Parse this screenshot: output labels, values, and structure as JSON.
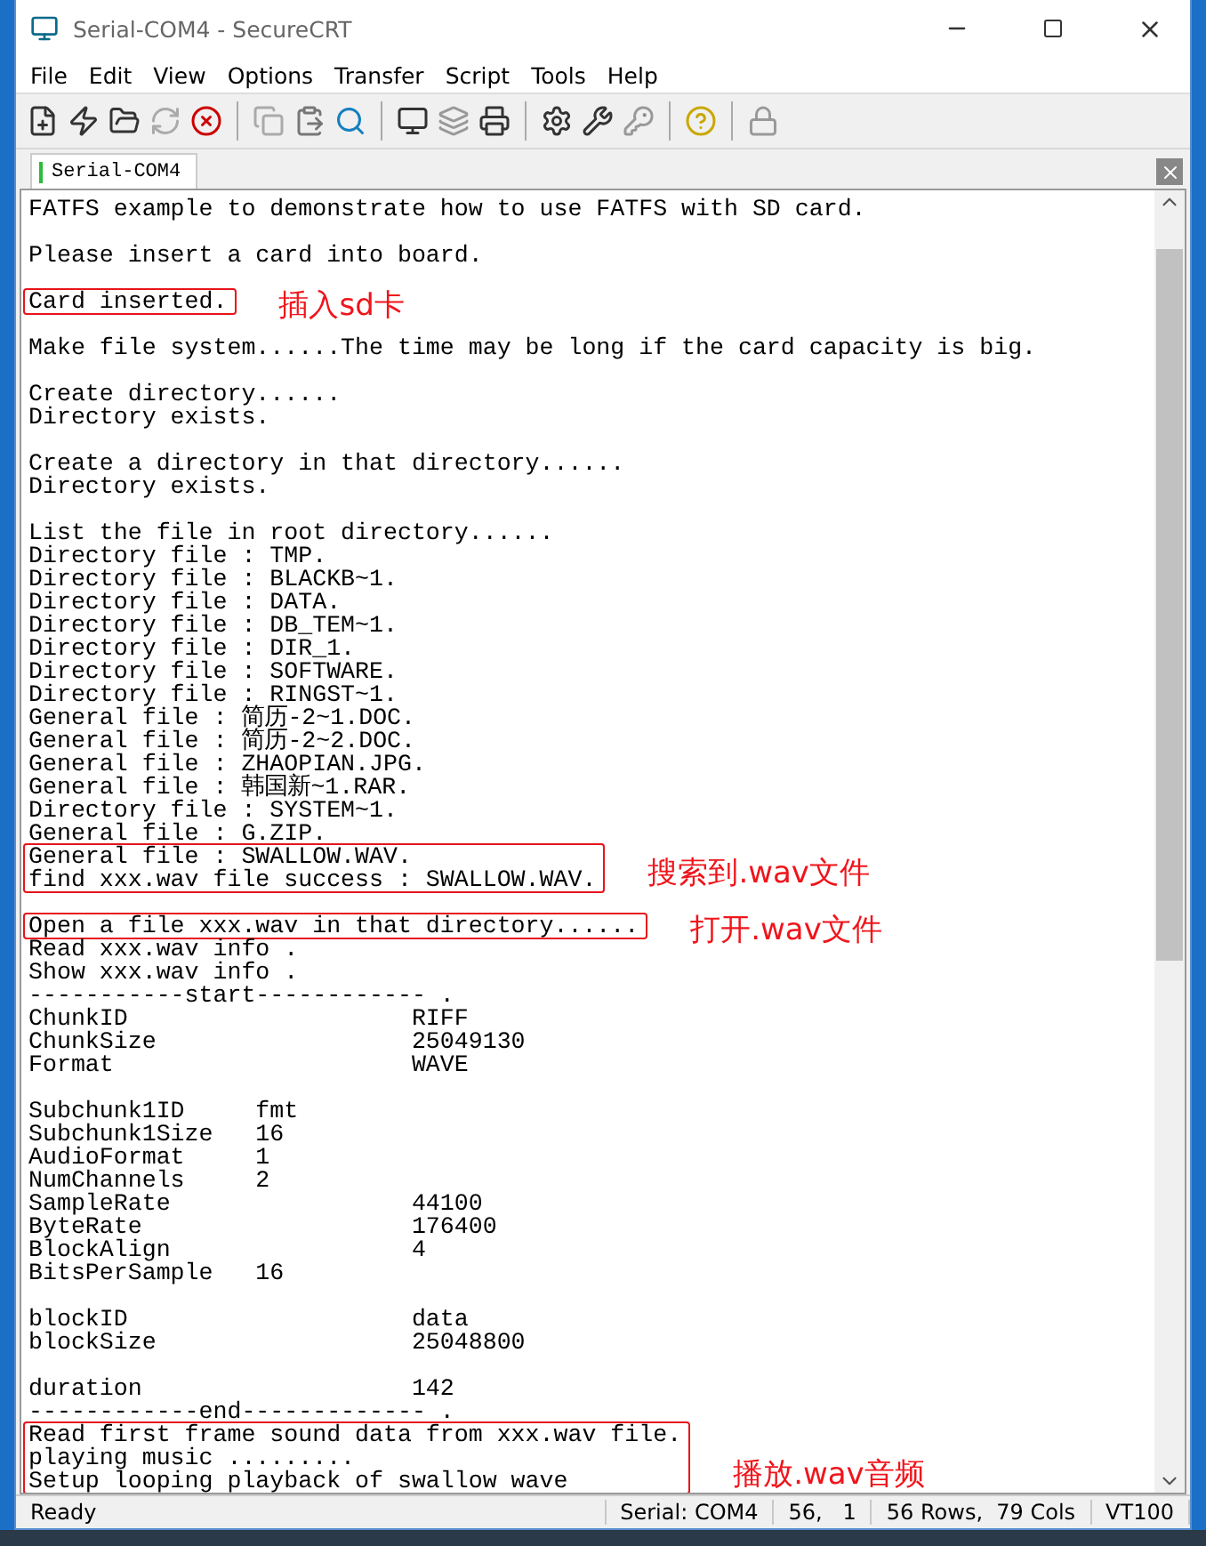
{
  "window": {
    "title": "Serial-COM4 - SecureCRT"
  },
  "menu": [
    "File",
    "Edit",
    "View",
    "Options",
    "Transfer",
    "Script",
    "Tools",
    "Help"
  ],
  "tabs": [
    {
      "label": "Serial-COM4",
      "selected": true
    }
  ],
  "terminal": {
    "blocks": [
      {
        "blank_before": false,
        "highlighted": false,
        "lines": [
          "FATFS example to demonstrate how to use FATFS with SD card."
        ]
      },
      {
        "blank_before": true,
        "highlighted": false,
        "lines": [
          "Please insert a card into board."
        ]
      },
      {
        "blank_before": true,
        "highlighted": true,
        "note": "插入sd卡",
        "lines": [
          "Card inserted."
        ]
      },
      {
        "blank_before": true,
        "highlighted": false,
        "lines": [
          "Make file system......The time may be long if the card capacity is big."
        ]
      },
      {
        "blank_before": true,
        "highlighted": false,
        "lines": [
          "Create directory......",
          "Directory exists."
        ]
      },
      {
        "blank_before": true,
        "highlighted": false,
        "lines": [
          "Create a directory in that directory......",
          "Directory exists."
        ]
      },
      {
        "blank_before": true,
        "highlighted": false,
        "lines": [
          "List the file in root directory......",
          "Directory file : TMP.",
          "Directory file : BLACKB~1.",
          "Directory file : DATA.",
          "Directory file : DB_TEM~1.",
          "Directory file : DIR_1.",
          "Directory file : SOFTWARE.",
          "Directory file : RINGST~1.",
          "General file : 简历-2~1.DOC.",
          "General file : 简历-2~2.DOC.",
          "General file : ZHAOPIAN.JPG.",
          "General file : 韩国新~1.RAR.",
          "Directory file : SYSTEM~1.",
          "General file : G.ZIP."
        ]
      },
      {
        "blank_before": false,
        "highlighted": true,
        "note": "搜索到.wav文件",
        "lines": [
          "General file : SWALLOW.WAV.",
          "find xxx.wav file success : SWALLOW.WAV."
        ]
      },
      {
        "blank_before": true,
        "highlighted": true,
        "note": "打开.wav文件",
        "lines": [
          "Open a file xxx.wav in that directory......"
        ]
      },
      {
        "blank_before": false,
        "highlighted": false,
        "lines": [
          "Read xxx.wav info .",
          "Show xxx.wav info .",
          "-----------start------------ .",
          "ChunkID                    RIFF",
          "ChunkSize                  25049130",
          "Format                     WAVE"
        ]
      },
      {
        "blank_before": true,
        "highlighted": false,
        "lines": [
          "Subchunk1ID     fmt",
          "Subchunk1Size   16",
          "AudioFormat     1",
          "NumChannels     2",
          "SampleRate                 44100",
          "ByteRate                   176400",
          "BlockAlign                 4",
          "BitsPerSample   16"
        ]
      },
      {
        "blank_before": true,
        "highlighted": false,
        "lines": [
          "blockID                    data",
          "blockSize                  25048800"
        ]
      },
      {
        "blank_before": true,
        "highlighted": false,
        "lines": [
          "duration                   142",
          "------------end------------- ."
        ]
      },
      {
        "blank_before": false,
        "highlighted": true,
        "note": "播放.wav音频",
        "lines": [
          "Read first frame sound data from xxx.wav file.",
          "playing music .........",
          "Setup looping playback of swallow wave"
        ]
      }
    ]
  },
  "status_bar": [
    "Ready",
    "Serial: COM4",
    "56,   1",
    "56 Rows,  79 Cols",
    "VT100"
  ]
}
